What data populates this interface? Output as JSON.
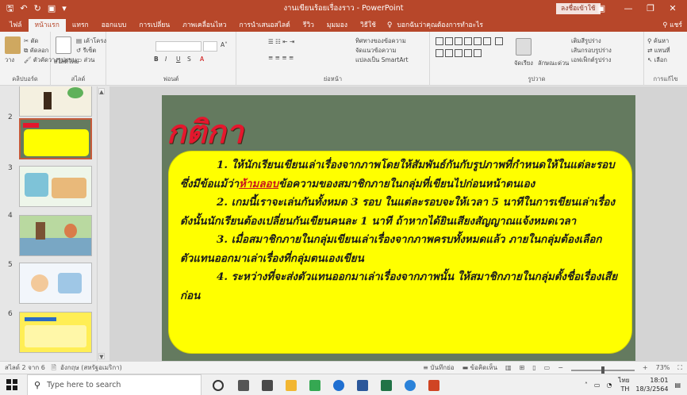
{
  "window": {
    "title": "งานเขียนร้อยเรื่องราว - PowerPoint",
    "signin_label": "ลงชื่อเข้าใช้",
    "qat_icons": [
      "save-icon",
      "undo-icon",
      "redo-icon",
      "start-from-beginning-icon"
    ]
  },
  "ribbon": {
    "tabs": [
      "ไฟล์",
      "หน้าแรก",
      "แทรก",
      "ออกแบบ",
      "การเปลี่ยน",
      "ภาพเคลื่อนไหว",
      "การนำเสนอสไลด์",
      "รีวิว",
      "มุมมอง",
      "วิธีใช้"
    ],
    "active_tab_index": 1,
    "tell_me": "บอกฉันว่าคุณต้องการทำอะไร",
    "share": "แชร์",
    "groups": [
      {
        "label": "คลิปบอร์ด",
        "buttons": [
          "วาง",
          "ตัด",
          "คัดลอก",
          "ตัวคัดวางรูปแบบ"
        ]
      },
      {
        "label": "สไลด์",
        "buttons": [
          "สไลด์ใหม่",
          "เค้าโครง",
          "รีเซ็ต",
          "ส่วน"
        ]
      },
      {
        "label": "ฟอนต์",
        "buttons": [
          "B",
          "I",
          "U",
          "S"
        ]
      },
      {
        "label": "ย่อหน้า",
        "buttons": [
          "ทิศทางของข้อความ",
          "จัดแนวข้อความ",
          "แปลงเป็น SmartArt"
        ]
      },
      {
        "label": "รูปวาด",
        "buttons": [
          "จัดเรียง",
          "ลักษณะด่วน",
          "เติมสีรูปร่าง",
          "เส้นกรอบรูปร่าง",
          "เอฟเฟ็กต์รูปร่าง"
        ]
      },
      {
        "label": "การแก้ไข",
        "buttons": [
          "ค้นหา",
          "แทนที่",
          "เลือก"
        ]
      }
    ]
  },
  "thumbnails": [
    {
      "number": "2",
      "selected": true
    },
    {
      "number": "3",
      "selected": false
    },
    {
      "number": "4",
      "selected": false
    },
    {
      "number": "5",
      "selected": false
    },
    {
      "number": "6",
      "selected": false
    }
  ],
  "slide": {
    "title": "กติกา",
    "rules": [
      {
        "before": "1. ให้นักเรียนเขียนเล่าเรื่องจากภาพโดยให้สัมพันธ์กันกับรูปภาพที่กำหนดให้ในแต่ละรอบ ซึ่งมีข้อแม้ว่า",
        "link": "ห้ามลอบ",
        "after": "ข้อความของสมาชิกภายในกลุ่มที่เขียนไปก่อนหน้าตนเอง"
      },
      {
        "before": "2. เกมนี้เราจะเล่นกันทั้งหมด 3 รอบ ในแต่ละรอบจะให้เวลา 5 นาทีในการเขียนเล่าเรื่อง ดังนั้นนักเรียนต้องเปลี่ยนกันเขียนคนละ 1 นาที ถ้าหากได้ยินเสียงสัญญาณแจ้งหมดเวลา",
        "link": "",
        "after": ""
      },
      {
        "before": "3. เมื่อสมาชิกภายในกลุ่มเขียนเล่าเรื่องจากภาพครบทั้งหมดแล้ว ภายในกลุ่มต้องเลือกตัวแทนออกมาเล่าเรื่องที่กลุ่มตนเองเขียน",
        "link": "",
        "after": ""
      },
      {
        "before": "4. ระหว่างที่จะส่งตัวแทนออกมาเล่าเรื่องจากภาพนั้น ให้สมาชิกภายในกลุ่มตั้งชื่อเรื่องเสียก่อน",
        "link": "",
        "after": ""
      }
    ]
  },
  "status": {
    "slide_indicator": "สไลด์ 2 จาก 6",
    "language": "อังกฤษ (สหรัฐอเมริกา)",
    "notes": "บันทึกย่อ",
    "comments": "ข้อคิดเห็น",
    "zoom": "73%"
  },
  "taskbar": {
    "search_placeholder": "Type here to search",
    "lang_line1": "ไทย",
    "lang_line2": "TH",
    "time": "18:01",
    "date": "18/3/2564"
  },
  "colors": {
    "accent": "#b7472a",
    "slide_bg": "#647a5f",
    "box_fill": "#ffff00",
    "title_red": "#e4172d"
  }
}
